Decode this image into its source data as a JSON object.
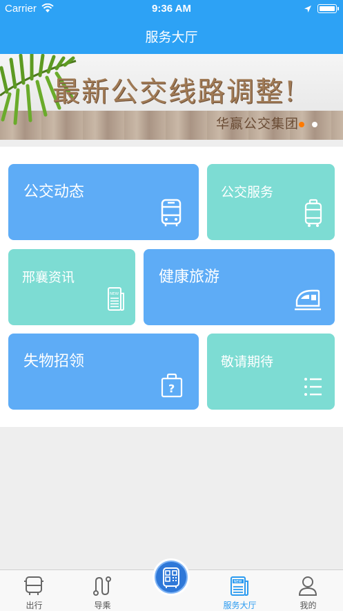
{
  "status_bar": {
    "carrier": "Carrier",
    "time": "9:36 AM",
    "battery_level": 1.0
  },
  "nav": {
    "title": "服务大厅"
  },
  "banner": {
    "headline": "最新公交线路调整!",
    "subline": "华赢公交集团",
    "active_slide": 1,
    "slide_count": 2
  },
  "tiles": [
    {
      "label": "公交动态",
      "icon": "bus-icon"
    },
    {
      "label": "公交服务",
      "icon": "luggage-icon"
    },
    {
      "label": "邢襄资讯",
      "icon": "news-icon"
    },
    {
      "label": "健康旅游",
      "icon": "train-icon"
    },
    {
      "label": "失物招领",
      "icon": "lost-bag-icon"
    },
    {
      "label": "敬请期待",
      "icon": "list-icon"
    }
  ],
  "tabbar": {
    "items": [
      {
        "label": "出行",
        "icon": "bus-icon"
      },
      {
        "label": "导乘",
        "icon": "route-icon"
      },
      {
        "label": "服务大厅",
        "icon": "news-icon"
      },
      {
        "label": "我的",
        "icon": "person-icon"
      }
    ],
    "center_icon": "qr-bus-icon",
    "active_index": 2
  },
  "colors": {
    "primary": "#2da2f5",
    "tile_blue": "#5eacf6",
    "tile_teal": "#7ddcd3",
    "tab_active": "#2a9af0"
  }
}
